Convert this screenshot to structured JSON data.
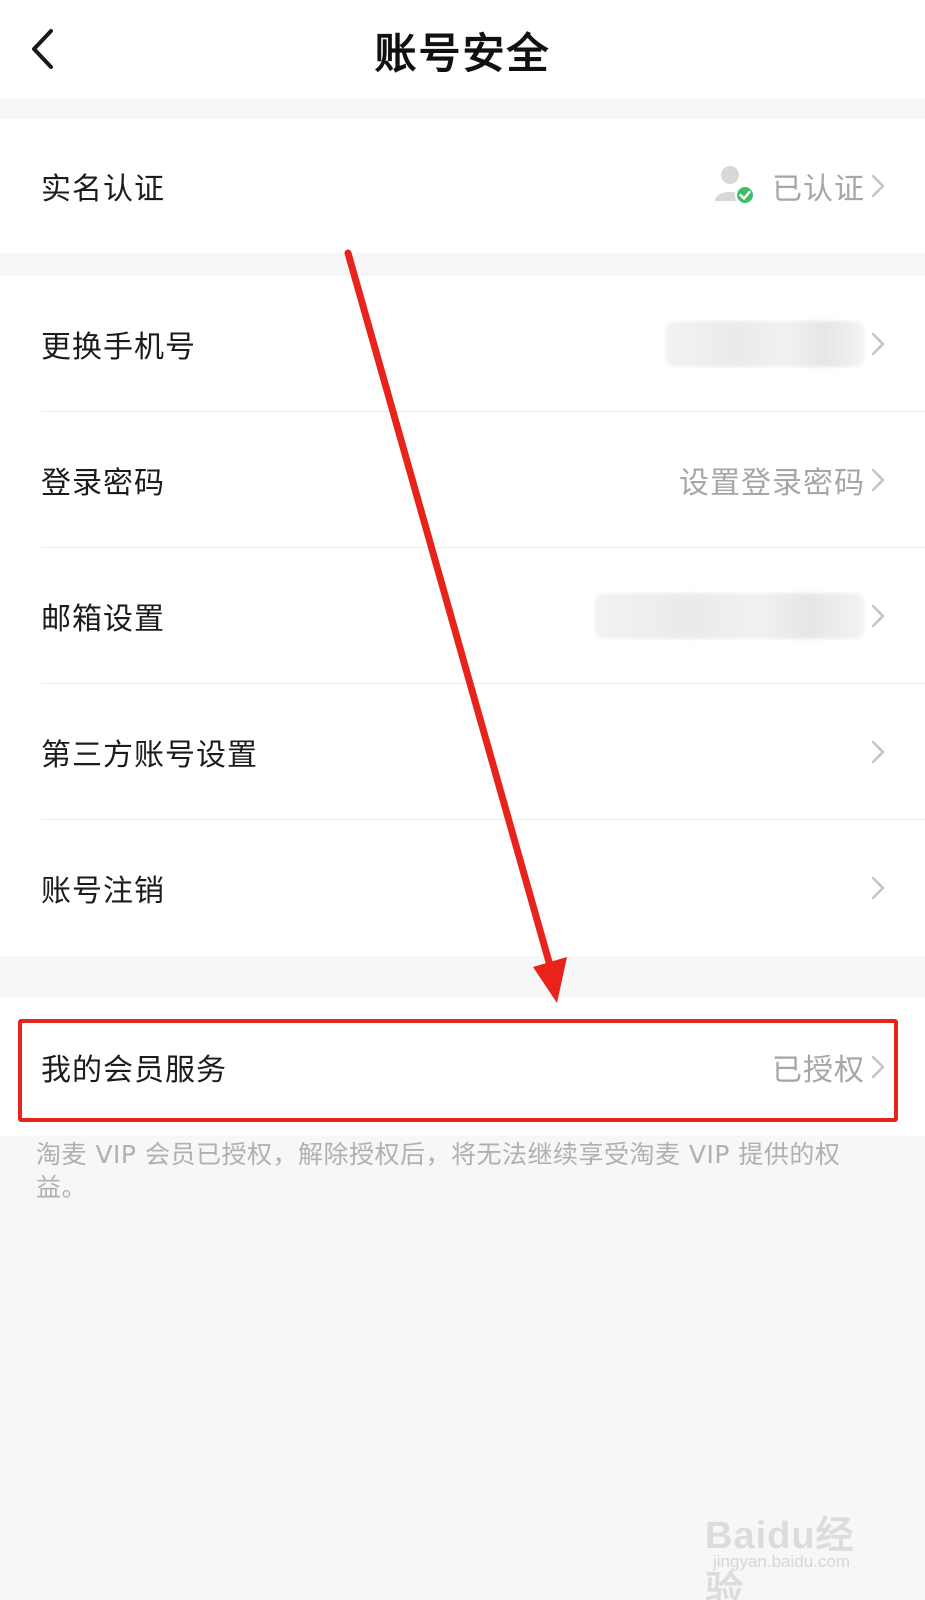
{
  "header": {
    "title": "账号安全",
    "back_icon": "chevron-left-icon"
  },
  "groups": [
    {
      "items": [
        {
          "label": "实名认证",
          "value": "已认证",
          "value_icon": "verified-user-icon"
        }
      ]
    },
    {
      "items": [
        {
          "label": "更换手机号",
          "value": "",
          "value_blurred": true
        },
        {
          "label": "登录密码",
          "value": "设置登录密码"
        },
        {
          "label": "邮箱设置",
          "value": "",
          "value_blurred": true
        },
        {
          "label": "第三方账号设置",
          "value": ""
        },
        {
          "label": "账号注销",
          "value": ""
        }
      ]
    },
    {
      "items": [
        {
          "label": "我的会员服务",
          "value": "已授权",
          "highlighted": true
        }
      ]
    }
  ],
  "note": "淘麦 VIP 会员已授权，解除授权后，将无法继续享受淘麦 VIP 提供的权益。",
  "annotation": {
    "arrow_color": "#e8231c",
    "box_color": "#e8231c"
  },
  "watermark": {
    "brand": "Baidu经验",
    "url": "jingyan.baidu.com"
  },
  "colors": {
    "background": "#f7f7f7",
    "card": "#ffffff",
    "secondary_text": "#a6a6a6",
    "verified_green": "#3dbf6a"
  }
}
